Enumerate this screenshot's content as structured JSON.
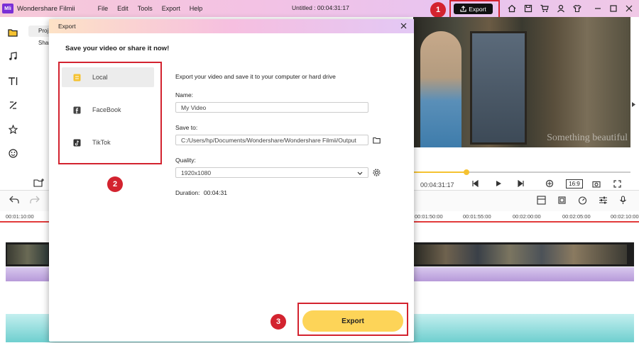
{
  "app": {
    "logo_text": "Mli",
    "name": "Wondershare Filmii",
    "doc_title": "Untitled :  00:04:31:17"
  },
  "menu": [
    "File",
    "Edit",
    "Tools",
    "Export",
    "Help"
  ],
  "toolbar": {
    "export_label": "Export"
  },
  "sidebar": {
    "project_tab": "Proj",
    "share_tab": "Shar"
  },
  "preview": {
    "watermark": "Something beautiful",
    "time": "00:04:31:17",
    "aspect": "16:9",
    "progress_fraction": 0.245
  },
  "ruler": {
    "left": [
      "00:01:10:00"
    ],
    "right": [
      "00:01:50:00",
      "00:01:55:00",
      "00:02:00:00",
      "00:02:05:00",
      "00:02:10:00"
    ]
  },
  "dialog": {
    "title": "Export",
    "subtitle": "Save your video or share it now!",
    "options": [
      "Local",
      "FaceBook",
      "TikTok"
    ],
    "description": "Export your video and save it to your computer or hard drive",
    "name_label": "Name:",
    "name_value": "My Video",
    "save_label": "Save to:",
    "save_value": "C:/Users/hp/Documents/Wondershare/Wondershare Filmii/Output",
    "quality_label": "Quality:",
    "quality_value": "1920x1080",
    "duration_label": "Duration:",
    "duration_value": "00:04:31",
    "export_label": "Export"
  },
  "annotations": {
    "b1": "1",
    "b2": "2",
    "b3": "3"
  },
  "colors": {
    "accent_yellow": "#fdd458",
    "annotation_red": "#d3232f",
    "logo_purple": "#7a2fd6"
  }
}
